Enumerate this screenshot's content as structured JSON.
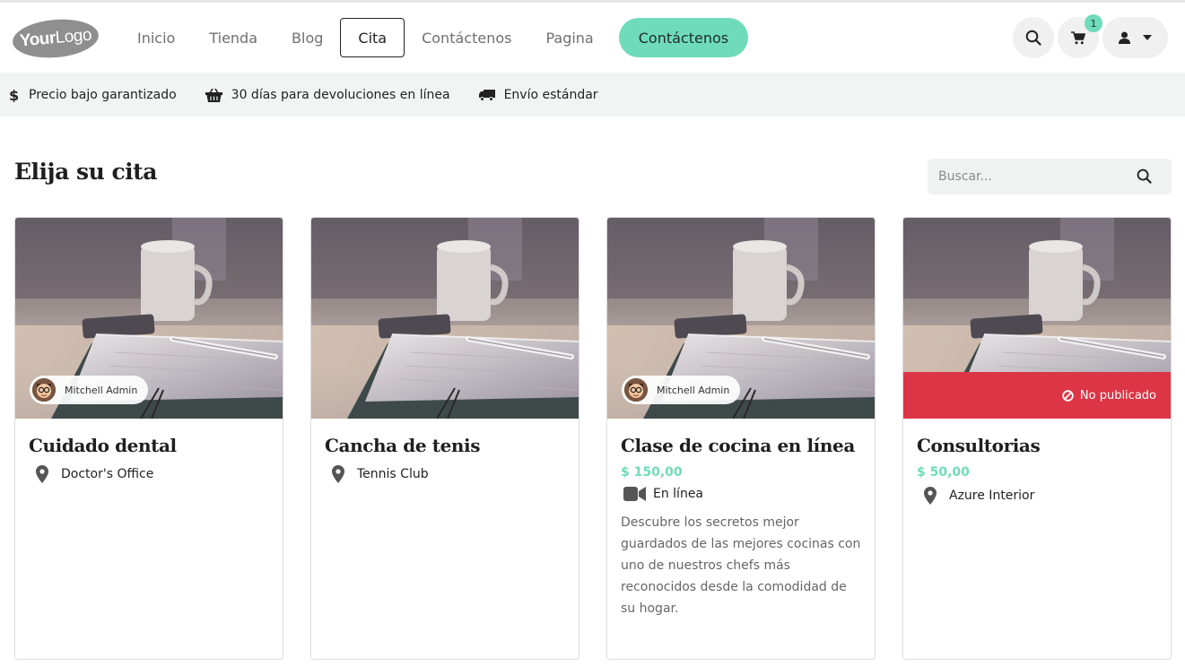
{
  "logo": {
    "bold": "Your",
    "thin": "Logo"
  },
  "nav": {
    "items": [
      {
        "label": "Inicio"
      },
      {
        "label": "Tienda"
      },
      {
        "label": "Blog"
      },
      {
        "label": "Cita"
      },
      {
        "label": "Contáctenos"
      },
      {
        "label": "Pagina"
      }
    ],
    "active": "Cita",
    "cta_label": "Contáctenos"
  },
  "header_buttons": {
    "cart_count": "1"
  },
  "infobar": {
    "items": [
      {
        "label": "Precio bajo garantizado",
        "icon": "dollar-icon"
      },
      {
        "label": "30 días para devoluciones en línea",
        "icon": "basket-icon"
      },
      {
        "label": "Envío estándar",
        "icon": "truck-icon"
      }
    ]
  },
  "page": {
    "title": "Elija su cita",
    "search_placeholder": "Buscar..."
  },
  "cards": [
    {
      "title": "Cuidado dental",
      "staff": "Mitchell Admin",
      "location": "Doctor's Office"
    },
    {
      "title": "Cancha de tenis",
      "location": "Tennis Club"
    },
    {
      "title": "Clase de cocina en línea",
      "staff": "Mitchell Admin",
      "price": "$ 150,00",
      "location": "En línea",
      "description": "Descubre los secretos mejor guardados de las mejores cocinas con uno de nuestros chefs más reconocidos desde la comodidad de su hogar."
    },
    {
      "title": "Consultorias",
      "badge": "No publicado",
      "price": "$ 50,00",
      "location": "Azure Interior"
    }
  ],
  "colors": {
    "accent": "#6fdbb9",
    "unpublished": "#dc3545",
    "infobar_bg": "#f0f4f3"
  }
}
